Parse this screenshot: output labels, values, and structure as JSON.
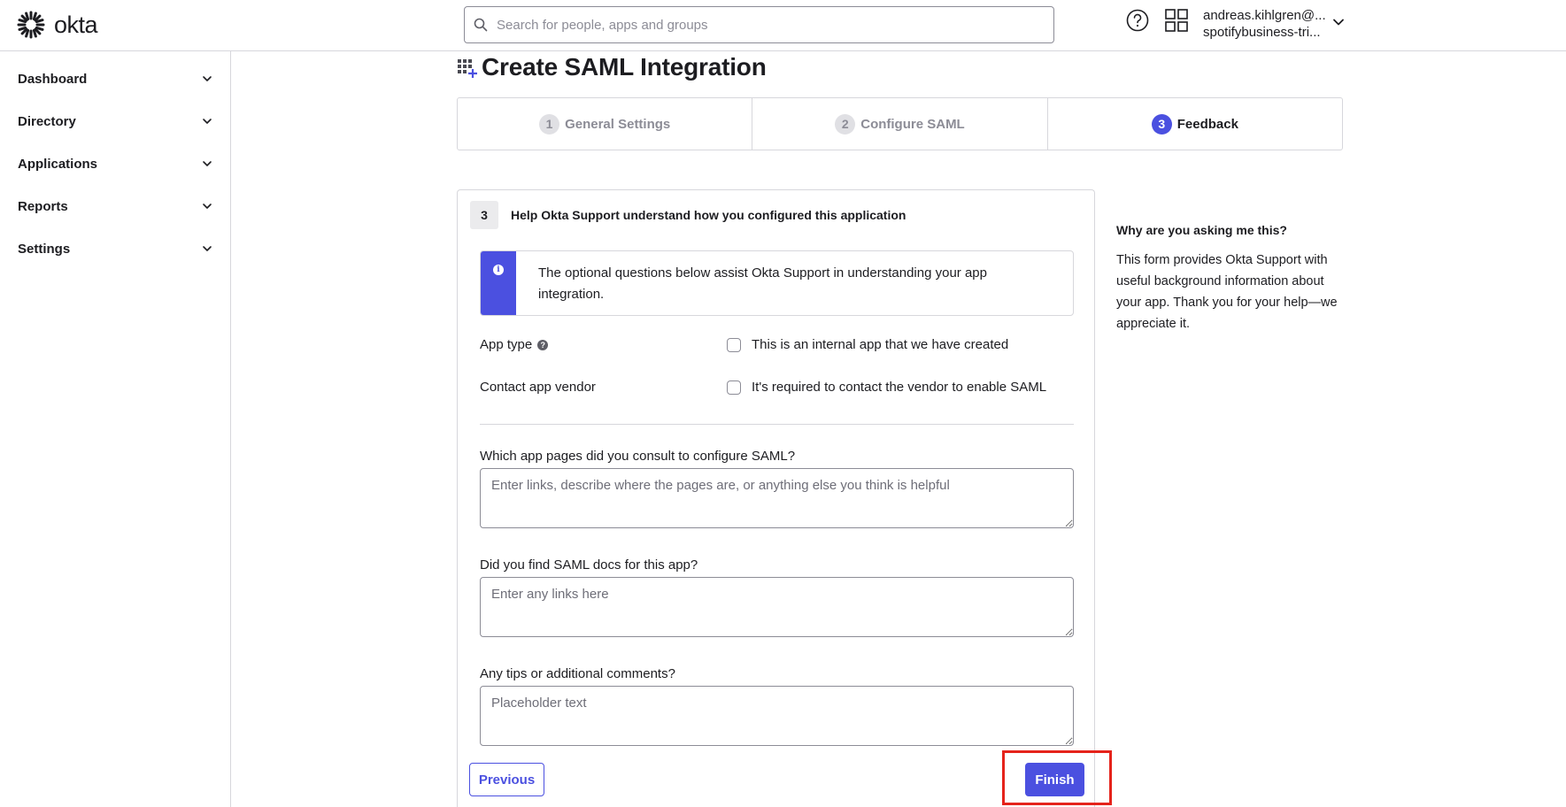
{
  "header": {
    "logo_text": "okta",
    "search_placeholder": "Search for people, apps and groups",
    "user_email": "andreas.kihlgren@...",
    "user_org": "spotifybusiness-tri..."
  },
  "sidebar": {
    "items": [
      {
        "label": "Dashboard"
      },
      {
        "label": "Directory"
      },
      {
        "label": "Applications"
      },
      {
        "label": "Reports"
      },
      {
        "label": "Settings"
      }
    ]
  },
  "page": {
    "title": "Create SAML Integration"
  },
  "steps": [
    {
      "num": "1",
      "label": "General Settings",
      "state": "done"
    },
    {
      "num": "2",
      "label": "Configure SAML",
      "state": "done"
    },
    {
      "num": "3",
      "label": "Feedback",
      "state": "active"
    }
  ],
  "form": {
    "step_num": "3",
    "heading": "Help Okta Support understand how you configured this application",
    "info_text": "The optional questions below assist Okta Support in understanding your app integration.",
    "app_type_label": "App type",
    "app_type_option": "This is an internal app that we have created",
    "contact_label": "Contact app vendor",
    "contact_option": "It's required to contact the vendor to enable SAML",
    "q1_label": "Which app pages did you consult to configure SAML?",
    "q1_placeholder": "Enter links, describe where the pages are, or anything else you think is helpful",
    "q2_label": "Did you find SAML docs for this app?",
    "q2_placeholder": "Enter any links here",
    "q3_label": "Any tips or additional comments?",
    "q3_placeholder": "Placeholder text",
    "previous_label": "Previous",
    "finish_label": "Finish"
  },
  "aside": {
    "heading": "Why are you asking me this?",
    "body": "This form provides Okta Support with useful background information about your app. Thank you for your help—we appreciate it."
  },
  "colors": {
    "accent": "#4b50e0",
    "highlight": "#e5231b"
  }
}
